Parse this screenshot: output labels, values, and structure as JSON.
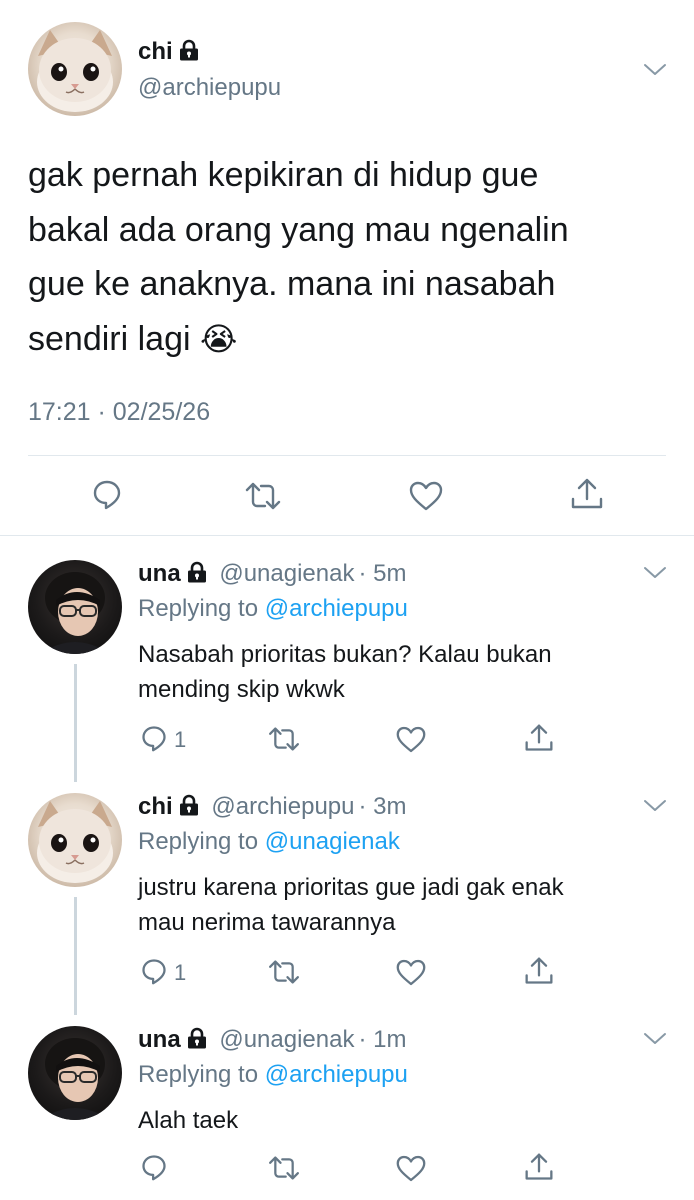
{
  "main_tweet": {
    "name": "chi",
    "handle": "@archiepupu",
    "text_lines": [
      "gak pernah kepikiran di hidup gue",
      "bakal ada orang yang mau ngenalin",
      "gue ke anaknya. mana ini nasabah",
      "sendiri lagi"
    ],
    "emoji": "😭",
    "timestamp": "17:21 · 02/25/26"
  },
  "replies": [
    {
      "name": "una",
      "handle": "@unagienak",
      "time": "· 5m",
      "replying_label": "Replying to",
      "replying_to": "@archiepupu",
      "text_lines": [
        "Nasabah prioritas bukan? Kalau bukan",
        "mending skip wkwk"
      ],
      "reply_count": "1"
    },
    {
      "name": "chi",
      "handle": "@archiepupu",
      "time": "· 3m",
      "replying_label": "Replying to",
      "replying_to": "@unagienak",
      "text_lines": [
        "justru karena prioritas gue jadi gak enak",
        "mau nerima tawarannya"
      ],
      "reply_count": "1"
    },
    {
      "name": "una",
      "handle": "@unagienak",
      "time": "· 1m",
      "replying_label": "Replying to",
      "replying_to": "@archiepupu",
      "text_lines": [
        "Alah taek"
      ],
      "reply_count": ""
    }
  ],
  "icons": {
    "reply": "reply-icon",
    "retweet": "retweet-icon",
    "like": "heart-icon",
    "share": "share-icon",
    "lock": "lock-icon",
    "menu": "chevron-down-icon"
  },
  "colors": {
    "text": "#14171a",
    "secondary": "#657786",
    "link": "#1da1f2",
    "divider": "#e1e8ed",
    "thread_line": "#ccd6dd"
  }
}
